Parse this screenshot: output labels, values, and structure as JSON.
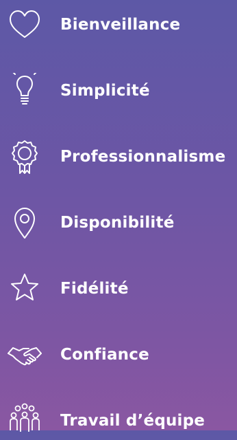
{
  "values": [
    {
      "label": "Bienveillance",
      "icon": "heart-icon"
    },
    {
      "label": "Simplicité",
      "icon": "lightbulb-icon"
    },
    {
      "label": "Professionnalisme",
      "icon": "award-ribbon-icon"
    },
    {
      "label": "Disponibilité",
      "icon": "map-pin-icon"
    },
    {
      "label": "Fidélité",
      "icon": "star-icon"
    },
    {
      "label": "Confiance",
      "icon": "handshake-icon"
    },
    {
      "label": "Travail d’équipe",
      "icon": "team-icon"
    }
  ],
  "colors": {
    "gradient_top": "#5d58a6",
    "gradient_bottom": "#8a57a2",
    "text": "#ffffff",
    "icon_stroke": "#ffffff"
  }
}
